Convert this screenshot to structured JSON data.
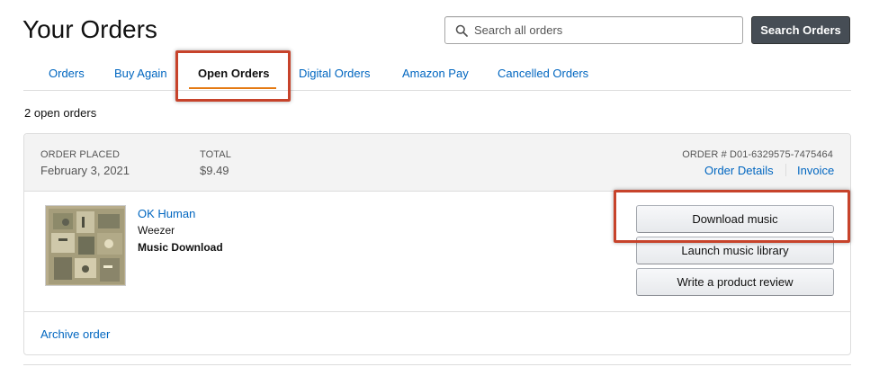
{
  "page": {
    "title": "Your Orders"
  },
  "search": {
    "placeholder": "Search all orders",
    "button_label": "Search Orders"
  },
  "tabs": [
    {
      "label": "Orders",
      "active": false
    },
    {
      "label": "Buy Again",
      "active": false
    },
    {
      "label": "Open Orders",
      "active": true
    },
    {
      "label": "Digital Orders",
      "active": false
    },
    {
      "label": "Amazon Pay",
      "active": false
    },
    {
      "label": "Cancelled Orders",
      "active": false
    }
  ],
  "orders_count_text": "2 open orders",
  "order": {
    "placed_label": "ORDER PLACED",
    "placed_value": "February 3, 2021",
    "total_label": "TOTAL",
    "total_value": "$9.49",
    "order_number_text": "ORDER # D01-6329575-7475464",
    "details_link": "Order Details",
    "invoice_link": "Invoice",
    "product": {
      "title": "OK Human",
      "artist": "Weezer",
      "format": "Music Download"
    },
    "actions": {
      "download": "Download music",
      "launch": "Launch music library",
      "review": "Write a product review"
    },
    "archive_link": "Archive order"
  },
  "colors": {
    "link": "#0066c0",
    "active_tab_underline": "#e47911",
    "highlight_outline": "#c7432b",
    "search_button_bg": "#464d55"
  },
  "icons": {
    "search": "search-icon"
  }
}
